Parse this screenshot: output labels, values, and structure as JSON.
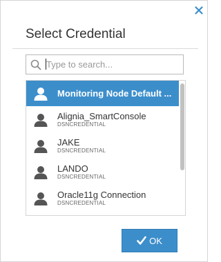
{
  "dialog": {
    "title": "Select Credential",
    "close_icon": "close-icon"
  },
  "search": {
    "placeholder": "Type to search...",
    "value": "",
    "icon": "search-icon"
  },
  "credentials": [
    {
      "name": "Monitoring Node Default ...",
      "type": "",
      "selected": true
    },
    {
      "name": "Alignia_SmartConsole",
      "type": "DSNCREDENTIAL",
      "selected": false
    },
    {
      "name": "JAKE",
      "type": "DSNCREDENTIAL",
      "selected": false
    },
    {
      "name": "LANDO",
      "type": "DSNCREDENTIAL",
      "selected": false
    },
    {
      "name": "Oracle11g Connection",
      "type": "DSNCREDENTIAL",
      "selected": false
    }
  ],
  "ok_button": {
    "label": "OK",
    "icon": "checkmark-icon"
  },
  "colors": {
    "accent": "#3c8ecb",
    "selected_text": "#ffffff",
    "close_icon": "#3c8ecb",
    "avatar_default": "#555555",
    "avatar_selected": "#ffffff"
  }
}
